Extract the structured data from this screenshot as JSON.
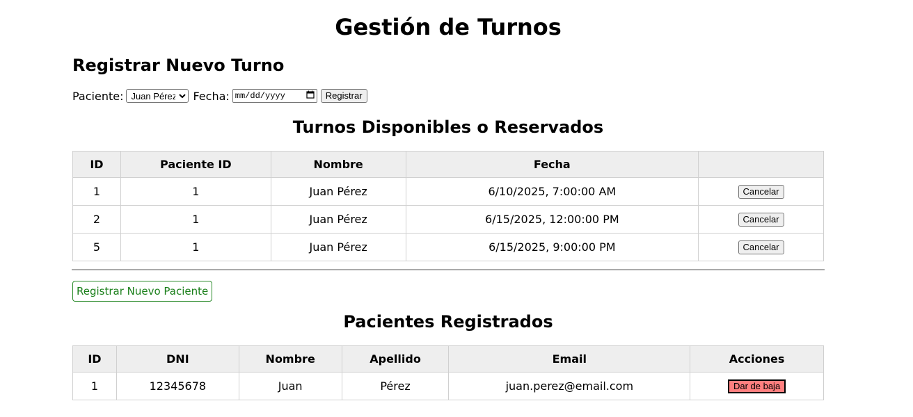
{
  "page_title": "Gestión de Turnos",
  "register_section": {
    "heading": "Registrar Nuevo Turno",
    "patient_label": "Paciente:",
    "patient_selected": "Juan Pérez",
    "date_label": "Fecha:",
    "date_placeholder": "mm/dd/yyyy",
    "submit_label": "Registrar"
  },
  "turnos_section": {
    "heading": "Turnos Disponibles o Reservados",
    "columns": [
      "ID",
      "Paciente ID",
      "Nombre",
      "Fecha",
      ""
    ],
    "rows": [
      {
        "id": "1",
        "paciente_id": "1",
        "nombre": "Juan Pérez",
        "fecha": "6/10/2025, 7:00:00 AM",
        "action": "Cancelar"
      },
      {
        "id": "2",
        "paciente_id": "1",
        "nombre": "Juan Pérez",
        "fecha": "6/15/2025, 12:00:00 PM",
        "action": "Cancelar"
      },
      {
        "id": "5",
        "paciente_id": "1",
        "nombre": "Juan Pérez",
        "fecha": "6/15/2025, 9:00:00 PM",
        "action": "Cancelar"
      }
    ]
  },
  "new_patient_button": "Registrar Nuevo Paciente",
  "pacientes_section": {
    "heading": "Pacientes Registrados",
    "columns": [
      "ID",
      "DNI",
      "Nombre",
      "Apellido",
      "Email",
      "Acciones"
    ],
    "rows": [
      {
        "id": "1",
        "dni": "12345678",
        "nombre": "Juan",
        "apellido": "Pérez",
        "email": "juan.perez@email.com",
        "action": "Dar de baja"
      }
    ]
  },
  "colors": {
    "header_bg": "#eeeeee",
    "new_patient_text": "#1a7f1a",
    "baja_button_bg": "#ff7f7f"
  },
  "icons": {
    "date_picker": "calendar-icon",
    "select_arrow": "chevron-down-icon"
  }
}
